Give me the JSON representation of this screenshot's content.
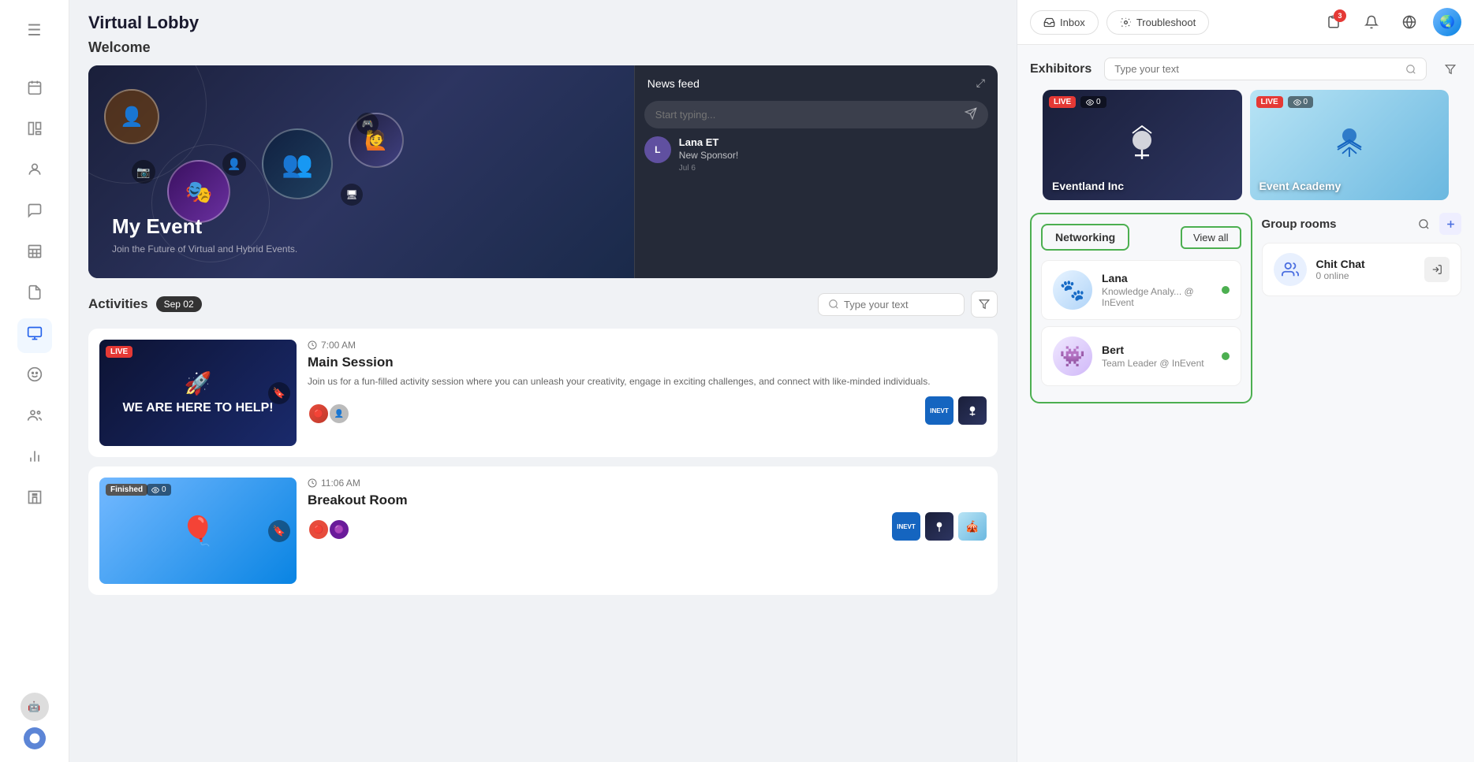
{
  "sidebar": {
    "items": [
      {
        "id": "menu",
        "icon": "☰",
        "label": "Menu"
      },
      {
        "id": "calendar",
        "icon": "📅",
        "label": "Calendar"
      },
      {
        "id": "layout",
        "icon": "⬜",
        "label": "Layout"
      },
      {
        "id": "people",
        "icon": "👤",
        "label": "People"
      },
      {
        "id": "chat",
        "icon": "💬",
        "label": "Chat"
      },
      {
        "id": "table",
        "icon": "⊞",
        "label": "Table"
      },
      {
        "id": "doc",
        "icon": "📄",
        "label": "Document"
      },
      {
        "id": "monitor",
        "icon": "🖥",
        "label": "Monitor",
        "active": true
      },
      {
        "id": "mask",
        "icon": "🎭",
        "label": "Mask"
      },
      {
        "id": "users",
        "icon": "👥",
        "label": "Users"
      },
      {
        "id": "chart",
        "icon": "📊",
        "label": "Chart"
      },
      {
        "id": "building",
        "icon": "🏢",
        "label": "Building"
      }
    ]
  },
  "page": {
    "title": "Virtual Lobby"
  },
  "welcome": {
    "label": "Welcome",
    "hero": {
      "event_name": "My Event",
      "event_desc": "Join the Future of Virtual and Hybrid Events.",
      "news_feed_title": "News feed",
      "input_placeholder": "Start typing...",
      "message": {
        "author": "Lana ET",
        "text": "New Sponsor!",
        "time": "Jul 6"
      }
    }
  },
  "activities": {
    "title": "Activities",
    "date": "Sep 02",
    "search_placeholder": "Type your text",
    "items": [
      {
        "id": "main-session",
        "status": "LIVE",
        "time": "7:00 AM",
        "name": "Main Session",
        "desc": "Join us for a fun-filled activity session where you can unleash your creativity, engage in exciting challenges, and connect with like-minded individuals.",
        "thumb_type": "helpdesk",
        "thumb_text": "WE ARE HERE TO HELP!"
      },
      {
        "id": "breakout-room",
        "status": "Finished",
        "eye_count": "0",
        "time": "11:06 AM",
        "name": "Breakout Room",
        "thumb_type": "blue"
      }
    ]
  },
  "right_panel": {
    "inbox_label": "Inbox",
    "troubleshoot_label": "Troubleshoot",
    "notif_count": "3",
    "exhibitors": {
      "title": "Exhibitors",
      "search_placeholder": "Type your text",
      "items": [
        {
          "id": "eventland",
          "name": "Eventland Inc",
          "theme": "dark",
          "live": true,
          "views": 0
        },
        {
          "id": "event-academy",
          "name": "Event Academy",
          "theme": "light",
          "live": true,
          "views": 0
        }
      ]
    },
    "networking": {
      "tab_label": "Networking",
      "view_all_label": "View all",
      "members": [
        {
          "id": "lana",
          "name": "Lana",
          "role": "Knowledge Analy... @ InEvent",
          "online": true
        },
        {
          "id": "bert",
          "name": "Bert",
          "role": "Team Leader @ InEvent",
          "online": true
        }
      ]
    },
    "group_rooms": {
      "title": "Group rooms",
      "items": [
        {
          "id": "chit-chat",
          "name": "Chit Chat",
          "count": "0 online"
        }
      ]
    }
  }
}
